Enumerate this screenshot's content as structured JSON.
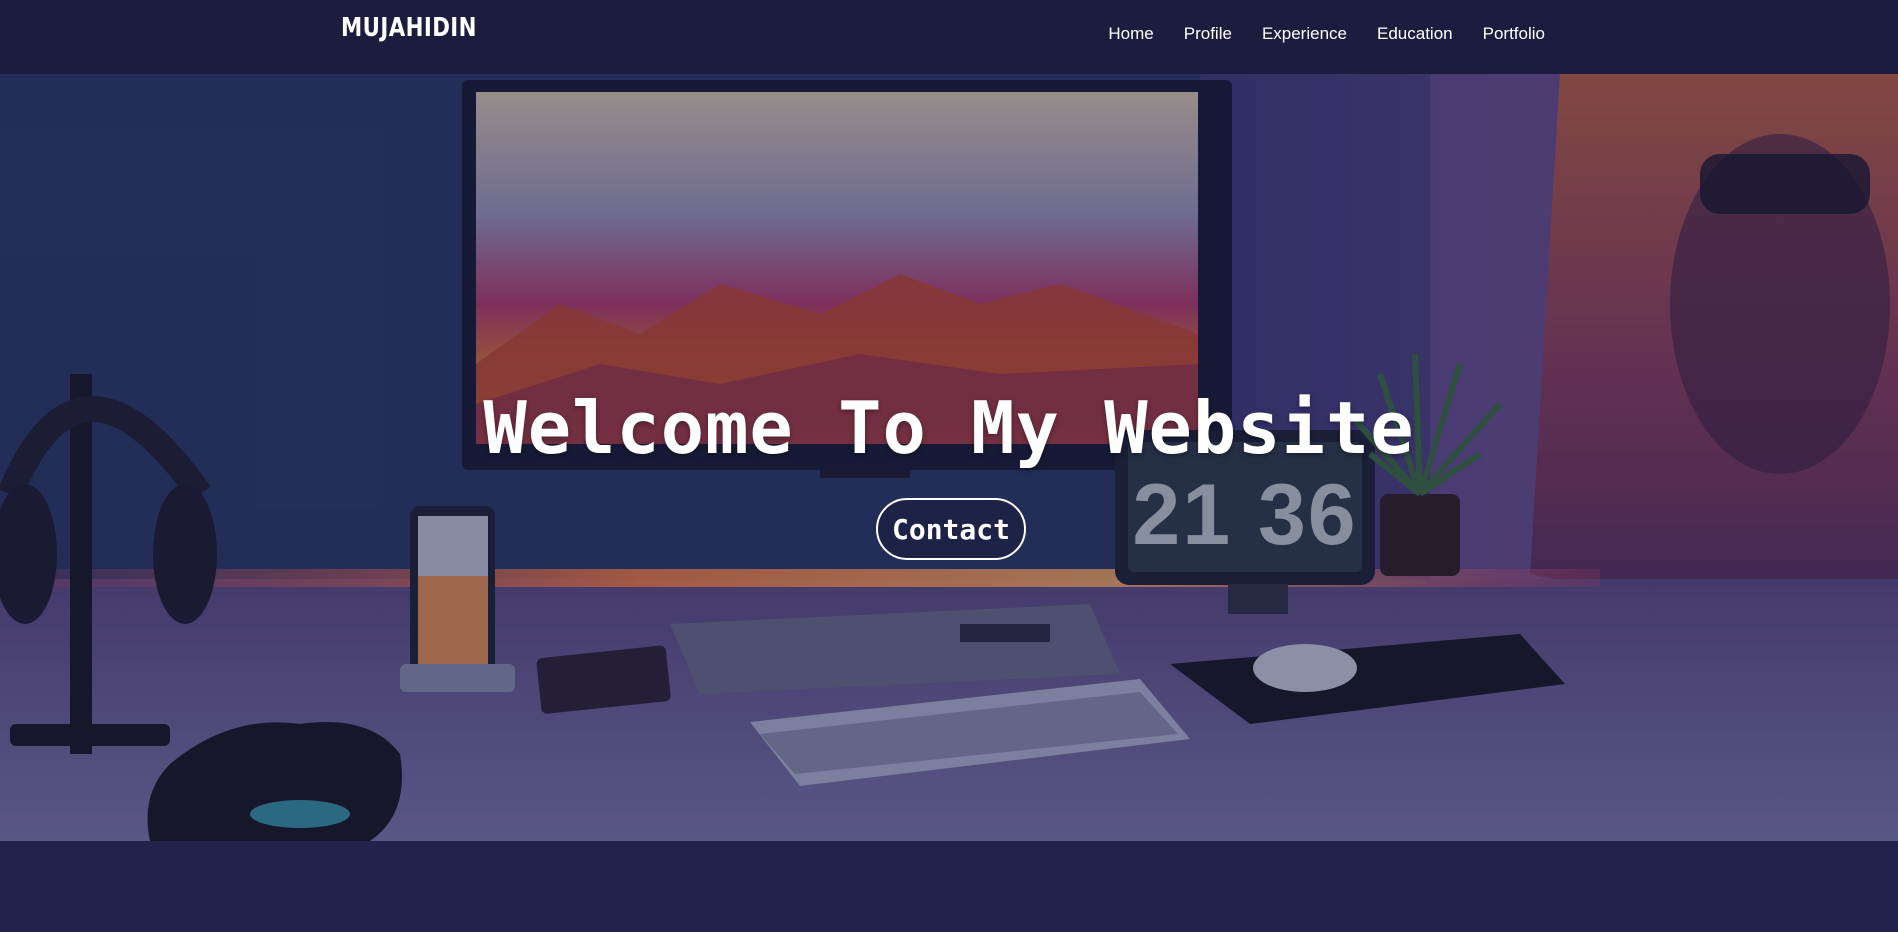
{
  "navbar": {
    "brand": "MUJAHIDIN",
    "links": [
      {
        "label": "Home"
      },
      {
        "label": "Profile"
      },
      {
        "label": "Experience"
      },
      {
        "label": "Education"
      },
      {
        "label": "Portfolio"
      }
    ]
  },
  "hero": {
    "title": "Welcome To My Website",
    "contact_label": "Contact",
    "background_image": "desk-setup-photo",
    "clock_display": "21 36"
  },
  "colors": {
    "navbar_bg": "#1c1c3e",
    "page_bg": "#22234a",
    "text": "#ffffff"
  }
}
